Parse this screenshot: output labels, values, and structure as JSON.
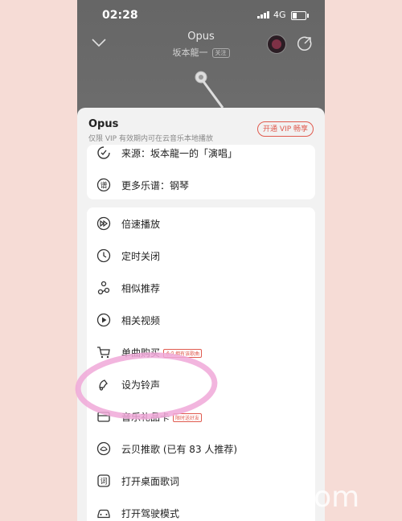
{
  "status_bar": {
    "time": "02:28",
    "network": "4G"
  },
  "player": {
    "song_title": "Opus",
    "artist": "坂本龍一",
    "follow_label": "关注"
  },
  "sheet": {
    "title": "Opus",
    "subtitle": "仅限 VIP 有效期内可在云音乐本地播放",
    "vip_button": "开通 VIP 畅享",
    "top_items": [
      {
        "label": "来源：坂本龍一的「演唱」",
        "icon": "source-icon"
      },
      {
        "label": "更多乐谱：钢琴",
        "icon": "score-icon"
      }
    ],
    "menu_items": [
      {
        "label": "倍速播放",
        "icon": "speed-icon"
      },
      {
        "label": "定时关闭",
        "icon": "timer-icon"
      },
      {
        "label": "相似推荐",
        "icon": "similar-icon"
      },
      {
        "label": "相关视频",
        "icon": "video-icon"
      },
      {
        "label": "单曲购买",
        "icon": "cart-icon",
        "tag": "永久拥有该歌曲"
      },
      {
        "label": "设为铃声",
        "icon": "ringtone-icon"
      },
      {
        "label": "音乐礼品卡",
        "icon": "gift-icon",
        "tag": "限时送好友"
      },
      {
        "label": "云贝推歌 (已有 83 人推荐)",
        "icon": "cloud-coin-icon"
      },
      {
        "label": "打开桌面歌词",
        "icon": "lyrics-icon"
      },
      {
        "label": "打开驾驶模式",
        "icon": "car-icon"
      }
    ]
  },
  "watermark": "khcoo.com",
  "colors": {
    "accent": "#e05a4e",
    "highlight": "#f0a8d8",
    "sheet_bg": "#f2f2f2"
  }
}
